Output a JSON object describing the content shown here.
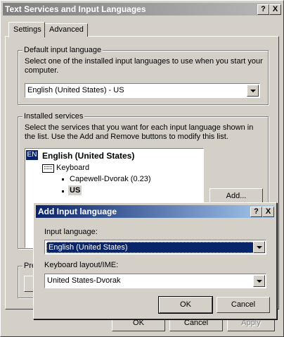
{
  "main_window": {
    "title": "Text Services and Input Languages",
    "help_button": "?",
    "close_button": "X",
    "tabs": [
      {
        "label": "Settings"
      },
      {
        "label": "Advanced"
      }
    ],
    "default_input": {
      "group_label": "Default input language",
      "description": "Select one of the installed input languages to use when you start your computer.",
      "selected": "English (United States) - US"
    },
    "installed_services": {
      "group_label": "Installed services",
      "description": "Select the services that you want for each input language shown in the list. Use the Add and Remove buttons to modify this list.",
      "tree": {
        "lang_badge": "EN",
        "language": "English (United States)",
        "category": "Keyboard",
        "items": [
          "Capewell-Dvorak (0.23)",
          "US"
        ]
      },
      "add_button": "Add..."
    },
    "preferences_label": "Pre",
    "footer": {
      "ok": "OK",
      "cancel": "Cancel",
      "apply": "Apply"
    }
  },
  "dialog": {
    "title": "Add Input language",
    "help_button": "?",
    "close_button": "X",
    "input_language_label": "Input language:",
    "input_language_value": "English (United States)",
    "keyboard_label": "Keyboard layout/IME:",
    "keyboard_value": "United States-Dvorak",
    "ok_label": "OK",
    "cancel_label": "Cancel"
  }
}
